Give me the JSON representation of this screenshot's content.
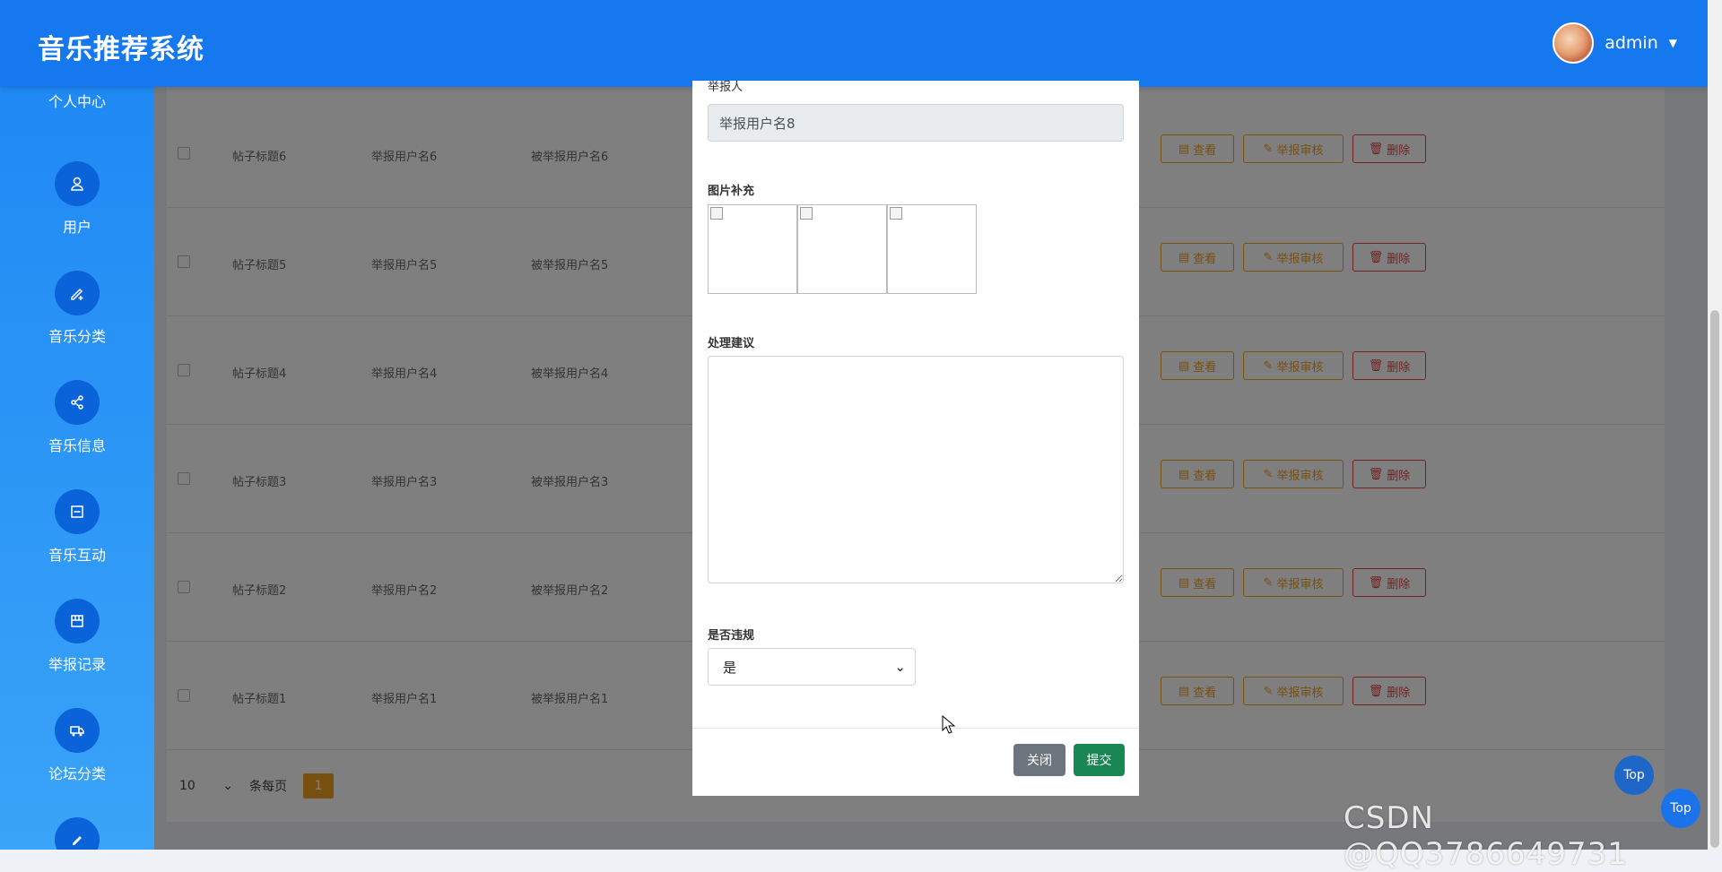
{
  "header": {
    "title": "音乐推荐系统",
    "username": "admin"
  },
  "sidebar": {
    "items": [
      {
        "label": "个人中心",
        "icon": "user-circle-icon"
      },
      {
        "label": "用户",
        "icon": "person-icon"
      },
      {
        "label": "音乐分类",
        "icon": "edit-plus-icon"
      },
      {
        "label": "音乐信息",
        "icon": "share-icon"
      },
      {
        "label": "音乐互动",
        "icon": "panel-icon"
      },
      {
        "label": "举报记录",
        "icon": "box-icon"
      },
      {
        "label": "论坛分类",
        "icon": "truck-icon"
      },
      {
        "label": "",
        "icon": "pencil-icon"
      }
    ]
  },
  "table": {
    "rows": [
      {
        "title": "帖子标题6",
        "reporter": "举报用户名6",
        "reported": "被举报用户名6"
      },
      {
        "title": "帖子标题5",
        "reporter": "举报用户名5",
        "reported": "被举报用户名5"
      },
      {
        "title": "帖子标题4",
        "reporter": "举报用户名4",
        "reported": "被举报用户名4"
      },
      {
        "title": "帖子标题3",
        "reporter": "举报用户名3",
        "reported": "被举报用户名3"
      },
      {
        "title": "帖子标题2",
        "reporter": "举报用户名2",
        "reported": "被举报用户名2"
      },
      {
        "title": "帖子标题1",
        "reporter": "举报用户名1",
        "reported": "被举报用户名1"
      }
    ],
    "actions": {
      "view": "查看",
      "audit": "举报审核",
      "delete": "删除"
    }
  },
  "pagination": {
    "page_size": "10",
    "per_page_label": "条每页",
    "current_page": "1"
  },
  "modal": {
    "top_label": "举报人",
    "reporter_value": "举报用户名8",
    "images_label": "图片补充",
    "advice_label": "处理建议",
    "advice_value": "",
    "violation_label": "是否违规",
    "violation_value": "是",
    "close_label": "关闭",
    "submit_label": "提交"
  },
  "floating": {
    "top_label_1": "Top",
    "top_label_2": "Top"
  },
  "watermark": "CSDN @QQ3786649731",
  "colors": {
    "header": "#1678ef",
    "warning": "#f0a020",
    "danger": "#e64545",
    "success": "#198754"
  }
}
